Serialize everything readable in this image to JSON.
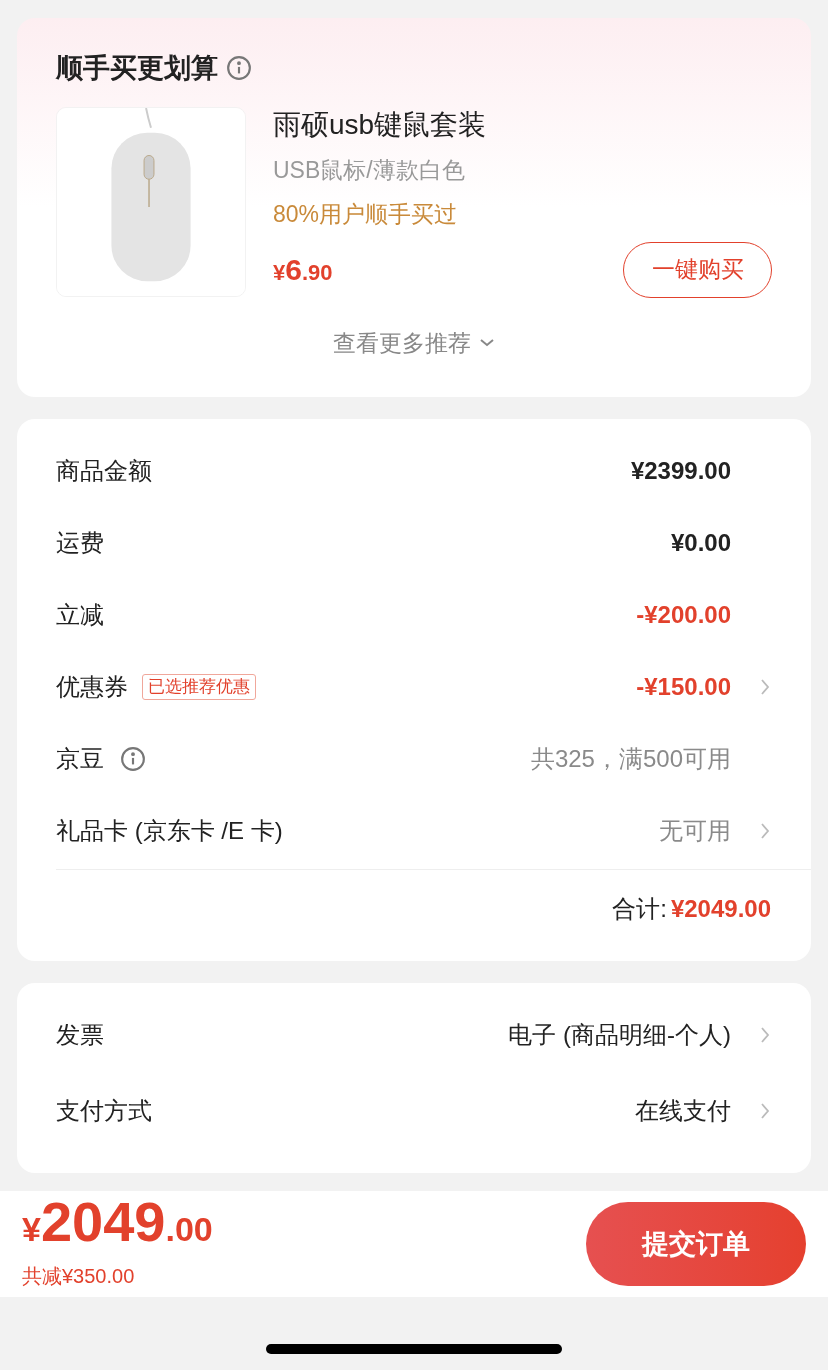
{
  "recommend": {
    "title": "顺手买更划算",
    "product": {
      "name": "雨硕usb键鼠套装",
      "variant": "USB鼠标/薄款白色",
      "social_proof": "80%用户顺手买过",
      "price": {
        "currency": "¥",
        "integer": "6",
        "decimal": ".90"
      },
      "buy_button": "一键购买"
    },
    "more": "查看更多推荐"
  },
  "summary": {
    "rows": [
      {
        "label": "商品金额",
        "value": "¥2399.00",
        "kind": "amount",
        "chevron": false
      },
      {
        "label": "运费",
        "value": "¥0.00",
        "kind": "amount",
        "chevron": false
      },
      {
        "label": "立减",
        "value": "-¥200.00",
        "kind": "discount",
        "chevron": false
      },
      {
        "label": "优惠券",
        "tag": "已选推荐优惠",
        "value": "-¥150.00",
        "kind": "discount",
        "chevron": true
      },
      {
        "label": "京豆",
        "info": true,
        "value": "共325，满500可用",
        "kind": "muted",
        "chevron": false
      },
      {
        "label": "礼品卡 (京东卡 /E 卡)",
        "value": "无可用",
        "kind": "muted",
        "chevron": true
      }
    ],
    "total_label": "合计:",
    "total_value": "¥2049.00"
  },
  "options": [
    {
      "label": "发票",
      "value": "电子 (商品明细-个人)"
    },
    {
      "label": "支付方式",
      "value": "在线支付"
    }
  ],
  "footer": {
    "price": {
      "currency": "¥",
      "integer": "2049",
      "decimal": ".00"
    },
    "saved": "共减¥350.00",
    "submit": "提交订单"
  }
}
